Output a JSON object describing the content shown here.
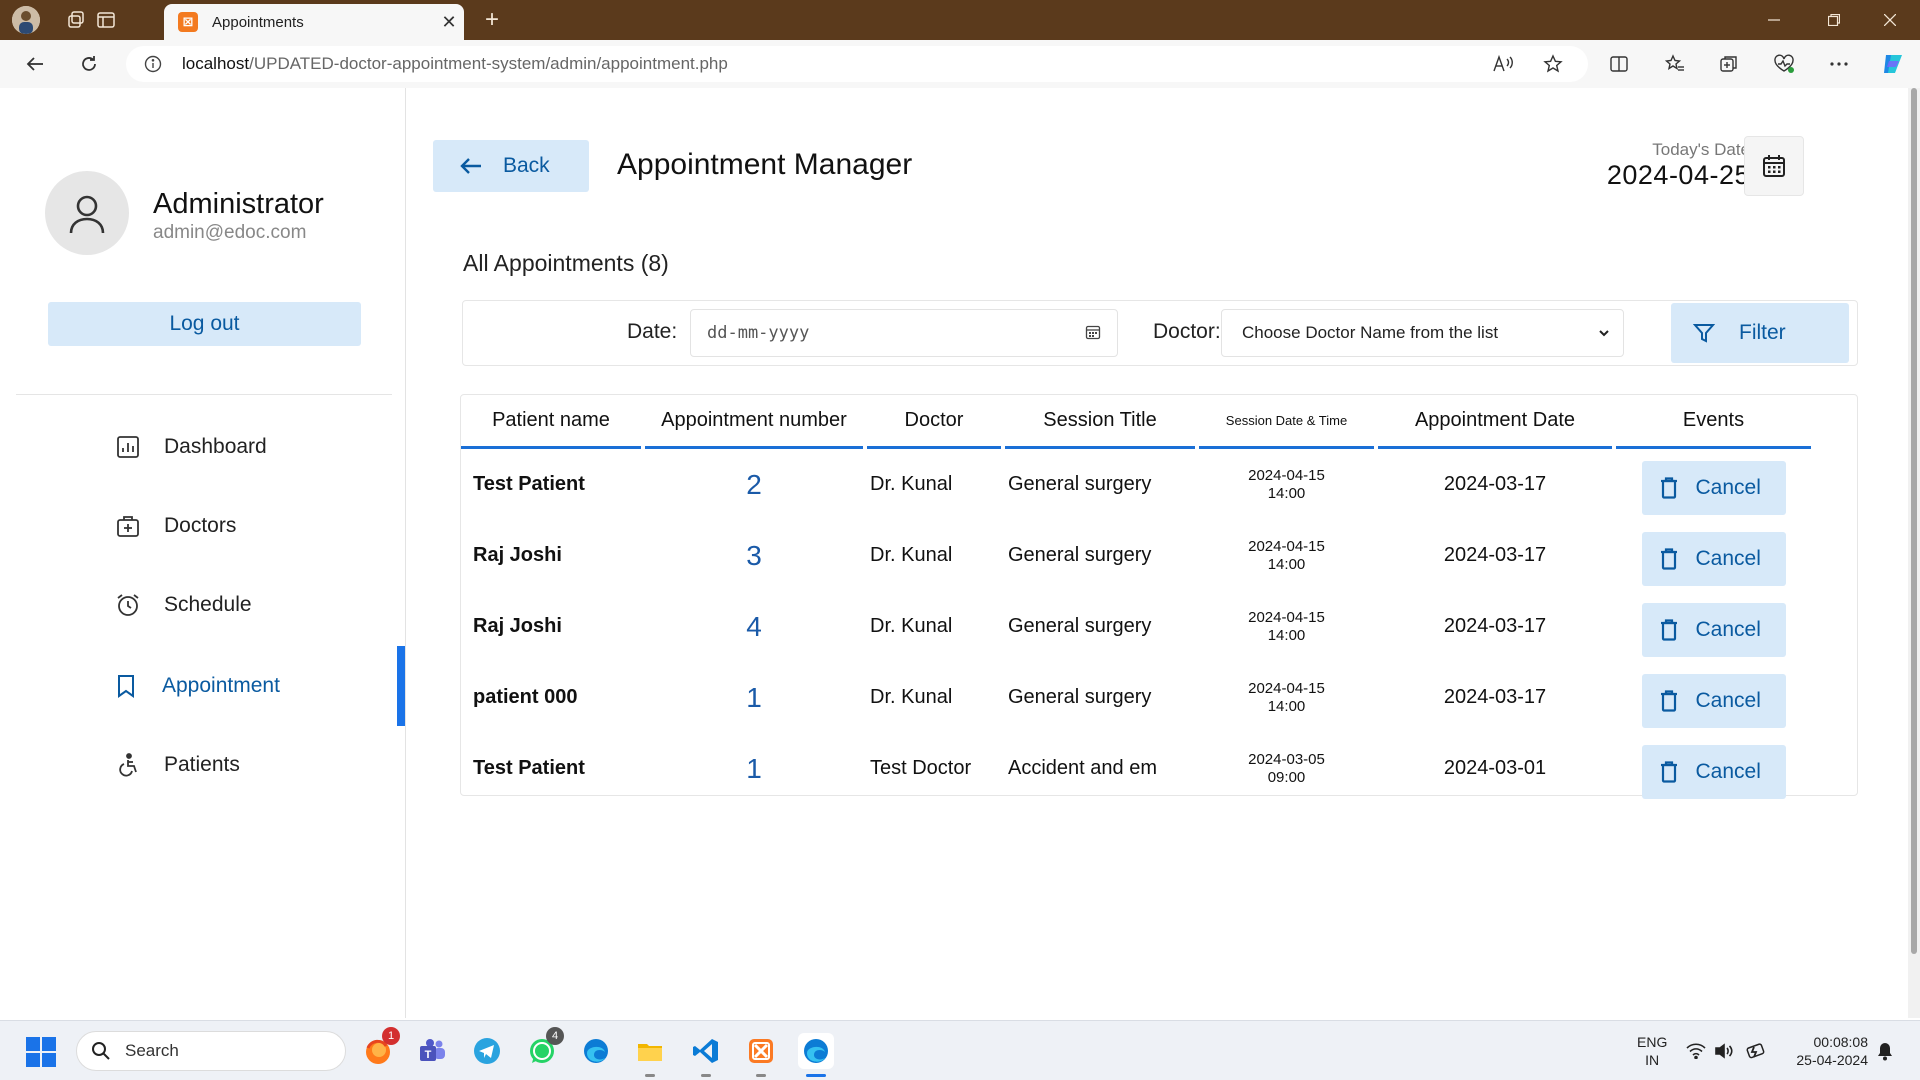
{
  "browser": {
    "tab_title": "Appointments",
    "url_host": "localhost",
    "url_path": "/UPDATED-doctor-appointment-system/admin/appointment.php"
  },
  "sidebar": {
    "profile_name": "Administrator",
    "profile_email": "admin@edoc.com",
    "logout_label": "Log out",
    "items": [
      {
        "label": "Dashboard",
        "icon": "dashboard-icon"
      },
      {
        "label": "Doctors",
        "icon": "doctor-bag-icon"
      },
      {
        "label": "Schedule",
        "icon": "alarm-clock-icon"
      },
      {
        "label": "Appointment",
        "icon": "bookmark-icon",
        "active": true
      },
      {
        "label": "Patients",
        "icon": "wheelchair-icon"
      }
    ]
  },
  "header": {
    "back_label": "Back",
    "title": "Appointment Manager",
    "today_label": "Today's Date",
    "today_value": "2024-04-25"
  },
  "list": {
    "heading": "All Appointments (8)"
  },
  "filter": {
    "date_label": "Date:",
    "date_placeholder": "dd-mm-yyyy",
    "doctor_label": "Doctor:",
    "doctor_selected": "Choose Doctor Name from the list",
    "filter_label": "Filter"
  },
  "table": {
    "columns": [
      "Patient name",
      "Appointment number",
      "Doctor",
      "Session Title",
      "Session Date & Time",
      "Appointment Date",
      "Events"
    ],
    "rows": [
      {
        "patient": "Test Patient",
        "number": "2",
        "doctor": "Dr. Kunal",
        "session": "General surgery",
        "session_date": "2024-04-15",
        "session_time": "14:00",
        "appt_date": "2024-03-17",
        "action": "Cancel"
      },
      {
        "patient": "Raj Joshi",
        "number": "3",
        "doctor": "Dr. Kunal",
        "session": "General surgery",
        "session_date": "2024-04-15",
        "session_time": "14:00",
        "appt_date": "2024-03-17",
        "action": "Cancel"
      },
      {
        "patient": "Raj Joshi",
        "number": "4",
        "doctor": "Dr. Kunal",
        "session": "General surgery",
        "session_date": "2024-04-15",
        "session_time": "14:00",
        "appt_date": "2024-03-17",
        "action": "Cancel"
      },
      {
        "patient": "patient 000",
        "number": "1",
        "doctor": "Dr. Kunal",
        "session": "General surgery",
        "session_date": "2024-04-15",
        "session_time": "14:00",
        "appt_date": "2024-03-17",
        "action": "Cancel"
      },
      {
        "patient": "Test Patient",
        "number": "1",
        "doctor": "Test Doctor",
        "session": "Accident and em",
        "session_date": "2024-03-05",
        "session_time": "09:00",
        "appt_date": "2024-03-01",
        "action": "Cancel"
      }
    ]
  },
  "taskbar": {
    "search_label": "Search",
    "badges": {
      "firefox": "1",
      "whatsapp": "4"
    },
    "lang_1": "ENG",
    "lang_2": "IN",
    "time": "00:08:08",
    "date": "25-04-2024"
  },
  "colors": {
    "accent": "#1a73e8",
    "button_bg": "#d7e9f9",
    "button_text": "#0a5aa0",
    "titlebar": "#5b3a1c"
  }
}
